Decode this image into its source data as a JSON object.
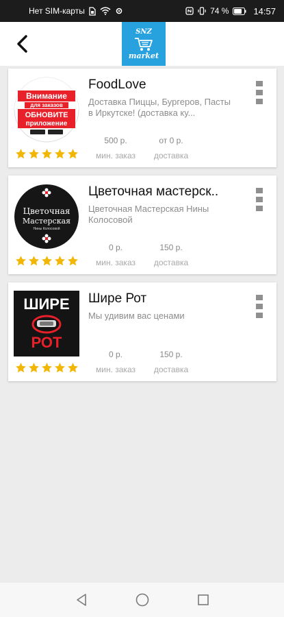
{
  "status_bar": {
    "carrier": "Нет SIM-карты",
    "battery": "74 %",
    "time": "14:57"
  },
  "header": {
    "logo_top": "SNZ",
    "logo_bottom": "market"
  },
  "stores": [
    {
      "name": "FoodLove",
      "description": "Доставка Пиццы, Бургеров, Пасты в Иркутске! (доставка ку...",
      "min_order": "500 р.",
      "min_order_label": "мин. заказ",
      "delivery": "от 0 р.",
      "delivery_label": "доставка",
      "rating": 5,
      "thumb": {
        "line1": "Внимание",
        "line2": "для заказов",
        "line3": "ОБНОВИТЕ",
        "line4": "приложение"
      }
    },
    {
      "name": "Цветочная мастерск..",
      "description": "Цветочная Мастерская Нины Колосовой",
      "min_order": "0 р.",
      "min_order_label": "мин. заказ",
      "delivery": "150 р.",
      "delivery_label": "доставка",
      "rating": 5,
      "thumb": {
        "line1": "Цветочная",
        "line2": "Мастерская",
        "line3": "Нины Колосовой"
      }
    },
    {
      "name": "Шире Рот",
      "description": "Мы удивим вас ценами",
      "min_order": "0 р.",
      "min_order_label": "мин. заказ",
      "delivery": "150 р.",
      "delivery_label": "доставка",
      "rating": 5,
      "thumb": {
        "line1": "ШИРЕ",
        "line2": "РОТ"
      }
    }
  ],
  "colors": {
    "star": "#f2b705",
    "logo_bg": "#27a2de",
    "card_bg": "#ffffff",
    "page_bg": "#ececec"
  },
  "icons": {
    "back": "arrow-left-icon",
    "menu": "more-vert-icon",
    "nav_back": "triangle-back-icon",
    "nav_home": "circle-home-icon",
    "nav_recent": "square-recent-icon"
  }
}
